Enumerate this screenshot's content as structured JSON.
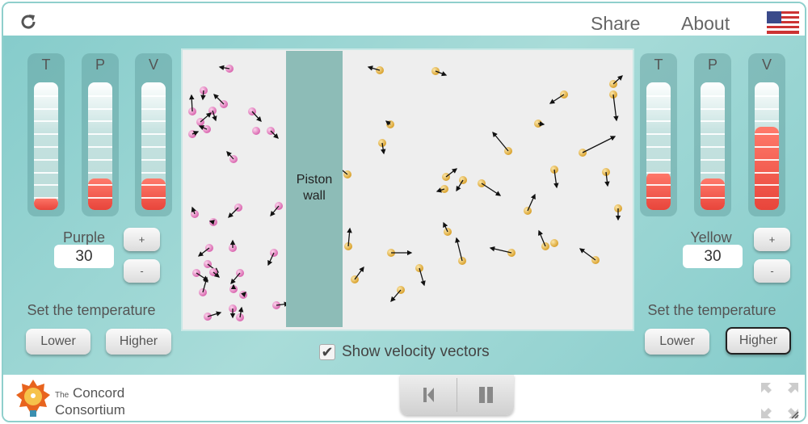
{
  "topbar": {
    "share": "Share",
    "about": "About",
    "flag": "us-flag-icon",
    "reload": "reload-icon"
  },
  "left": {
    "gauges": [
      {
        "label": "T",
        "level": 0.1
      },
      {
        "label": "P",
        "level": 0.25
      },
      {
        "label": "V",
        "level": 0.25
      }
    ],
    "gas_label": "Purple",
    "count": "30",
    "plus": "+",
    "minus": "-",
    "temp_label": "Set the temperature",
    "lower": "Lower",
    "higher": "Higher"
  },
  "right": {
    "gauges": [
      {
        "label": "T",
        "level": 0.3
      },
      {
        "label": "P",
        "level": 0.25
      },
      {
        "label": "V",
        "level": 0.65
      }
    ],
    "gas_label": "Yellow",
    "count": "30",
    "plus": "+",
    "minus": "-",
    "temp_label": "Set the temperature",
    "lower": "Lower",
    "higher": "Higher"
  },
  "sim": {
    "piston_line1": "Piston",
    "piston_line2": "wall",
    "purple_color": "#e27fc0",
    "yellow_color": "#e9b641"
  },
  "velocity": {
    "label": "Show velocity vectors",
    "checked": true
  },
  "footer": {
    "logo_line1": "The Concord",
    "logo_line2": "Consortium",
    "logo_the": "The",
    "logo_concord": "Concord",
    "logo_consortium": "Consortium"
  },
  "colors": {
    "teal": "#86cccb",
    "gauge_fill": "#e8453b"
  }
}
